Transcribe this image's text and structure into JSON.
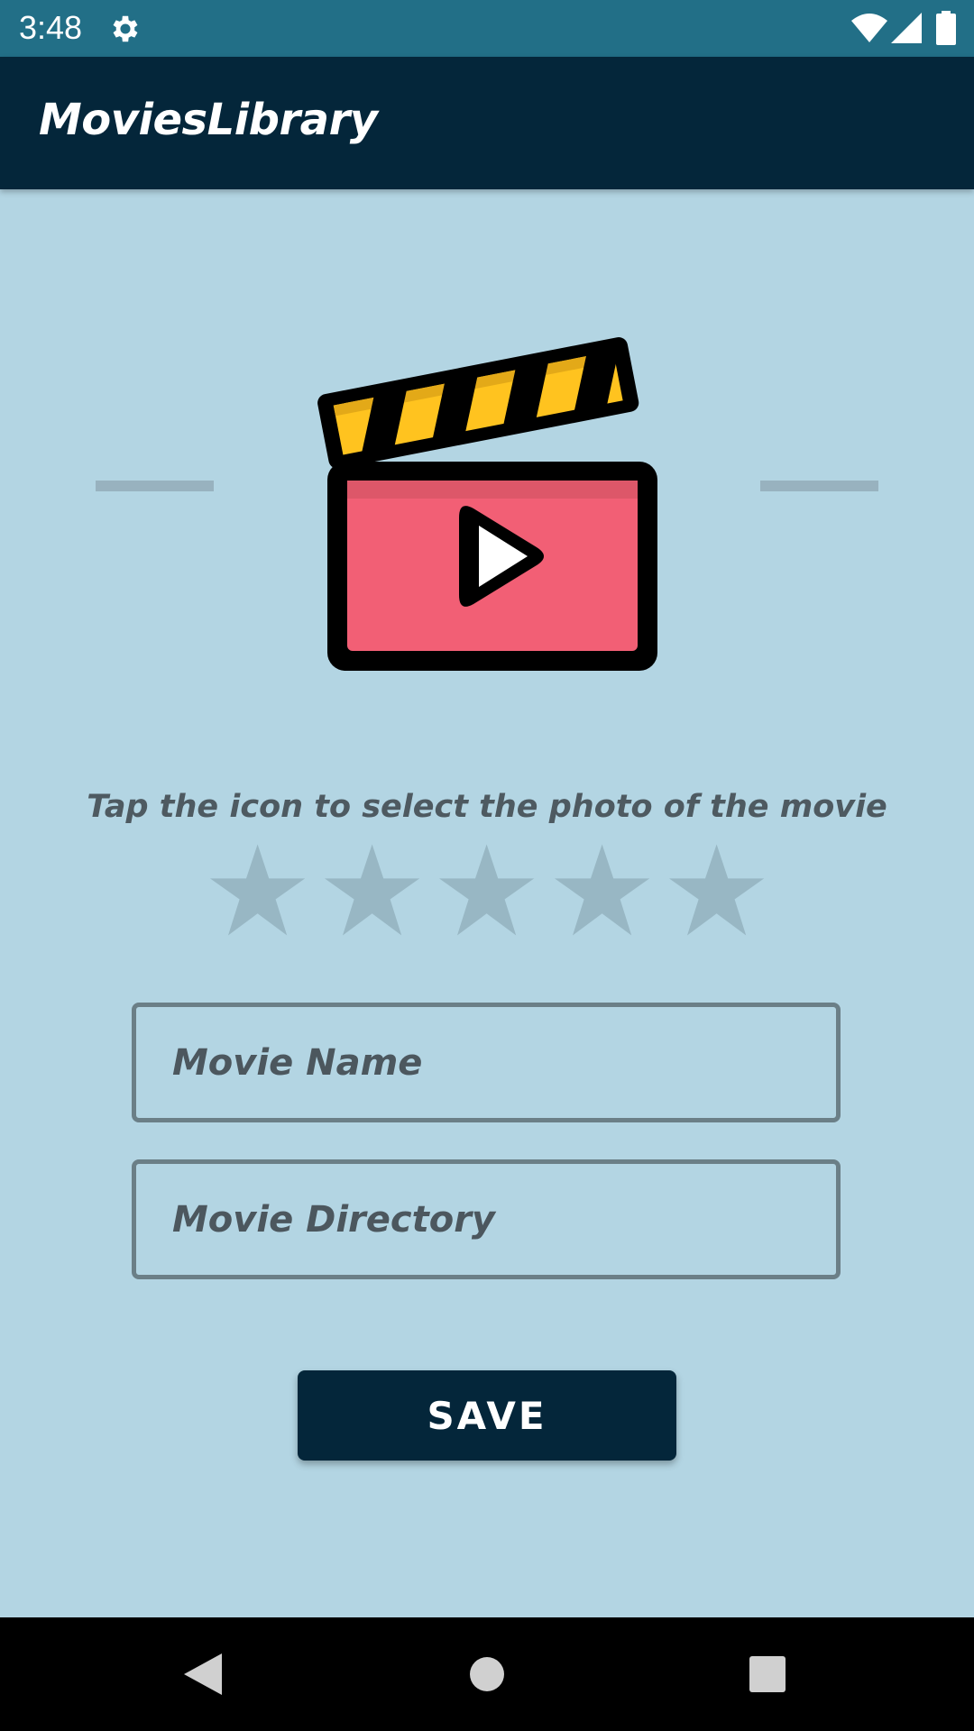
{
  "status_bar": {
    "time": "3:48",
    "icons": [
      "gear-icon",
      "wifi-icon",
      "signal-icon",
      "battery-icon"
    ]
  },
  "app_bar": {
    "title": "MoviesLibrary"
  },
  "main": {
    "image_icon": "clapperboard-play-icon",
    "hint": "Tap the icon to select the photo of the movie",
    "rating": {
      "max": 5,
      "value": 0
    },
    "movie_name": {
      "placeholder": "Movie Name",
      "value": ""
    },
    "movie_director": {
      "placeholder": "Movie Directory",
      "value": ""
    },
    "save_label": "SAVE"
  },
  "nav_bar": {
    "icons": [
      "back-icon",
      "home-icon",
      "recents-icon"
    ]
  },
  "colors": {
    "status_bar": "#226f87",
    "app_bar": "#04263a",
    "background": "#b3d5e3",
    "star_inactive": "#98b7c4",
    "field_border": "#6b7f87",
    "clapper_top": "#ffc31f",
    "clapper_body": "#f25f75"
  }
}
